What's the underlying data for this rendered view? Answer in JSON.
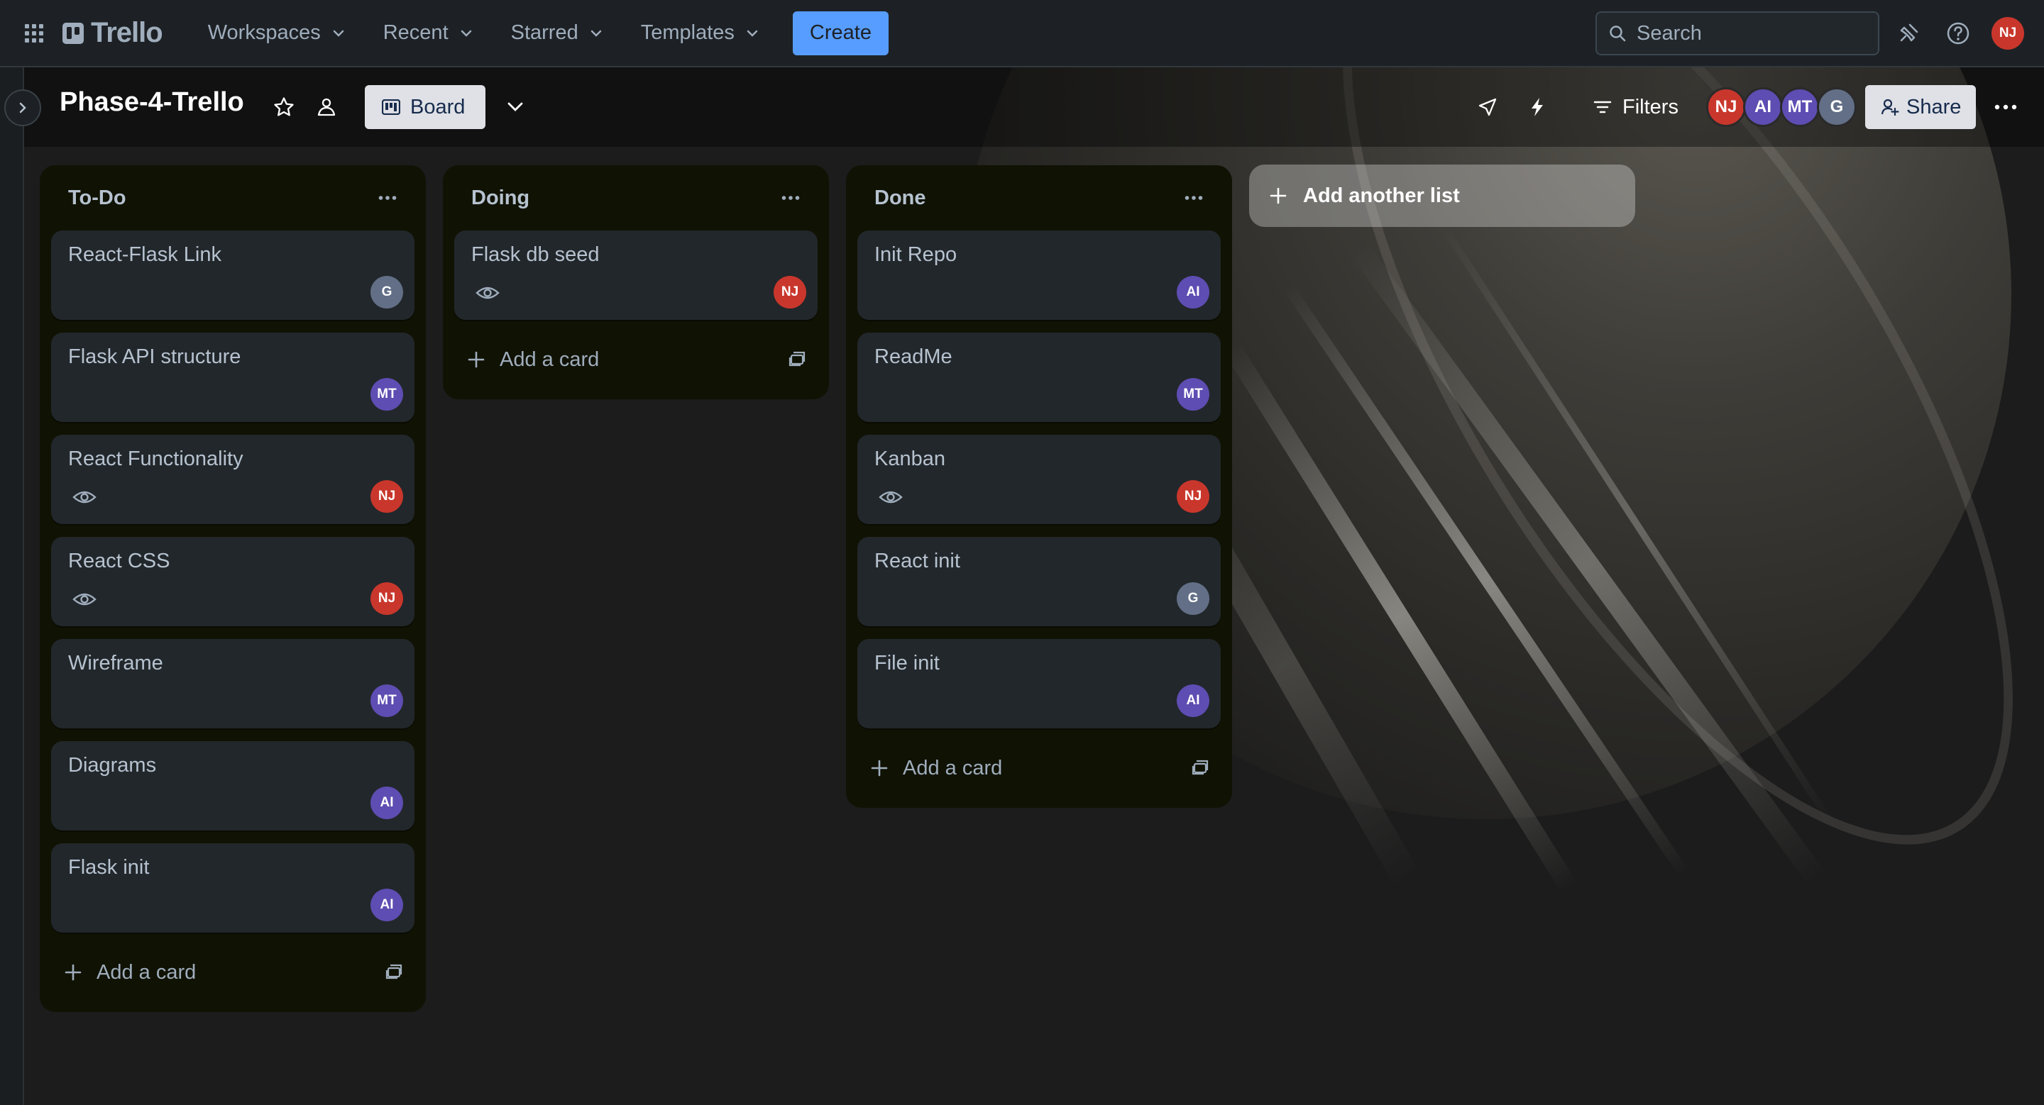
{
  "nav": {
    "logo_text": "Trello",
    "items": [
      {
        "label": "Workspaces"
      },
      {
        "label": "Recent"
      },
      {
        "label": "Starred"
      },
      {
        "label": "Templates"
      }
    ],
    "create_label": "Create",
    "search_placeholder": "Search",
    "user_initials": "NJ"
  },
  "board": {
    "title": "Phase-4-Trello",
    "view_label": "Board",
    "filters_label": "Filters",
    "share_label": "Share",
    "members": [
      {
        "initials": "NJ",
        "color": "#c9372c"
      },
      {
        "initials": "AI",
        "color": "#5e4db2"
      },
      {
        "initials": "MT",
        "color": "#5e4db2"
      },
      {
        "initials": "G",
        "color": "#626f86"
      }
    ]
  },
  "lists": [
    {
      "title": "To-Do",
      "add_card_label": "Add a card",
      "cards": [
        {
          "title": "React-Flask Link",
          "member": "G",
          "watch": false
        },
        {
          "title": "Flask API structure",
          "member": "MT",
          "watch": false
        },
        {
          "title": "React Functionality",
          "member": "NJ",
          "watch": true
        },
        {
          "title": "React CSS",
          "member": "NJ",
          "watch": true
        },
        {
          "title": "Wireframe",
          "member": "MT",
          "watch": false
        },
        {
          "title": "Diagrams",
          "member": "AI",
          "watch": false
        },
        {
          "title": "Flask init",
          "member": "AI",
          "watch": false
        }
      ]
    },
    {
      "title": "Doing",
      "add_card_label": "Add a card",
      "cards": [
        {
          "title": "Flask db seed",
          "member": "NJ",
          "watch": true
        }
      ]
    },
    {
      "title": "Done",
      "add_card_label": "Add a card",
      "cards": [
        {
          "title": "Init Repo",
          "member": "AI",
          "watch": false
        },
        {
          "title": "ReadMe",
          "member": "MT",
          "watch": false
        },
        {
          "title": "Kanban",
          "member": "NJ",
          "watch": true
        },
        {
          "title": "React init",
          "member": "G",
          "watch": false
        },
        {
          "title": "File init",
          "member": "AI",
          "watch": false
        }
      ]
    }
  ],
  "add_list_label": "Add another list",
  "colors": {
    "accent": "#579dff",
    "list_bg": "#101204",
    "card_bg": "#22272b",
    "avatar_nj": "#c9372c",
    "avatar_ai": "#5e4db2",
    "avatar_mt": "#5e4db2",
    "avatar_g": "#626f86"
  }
}
